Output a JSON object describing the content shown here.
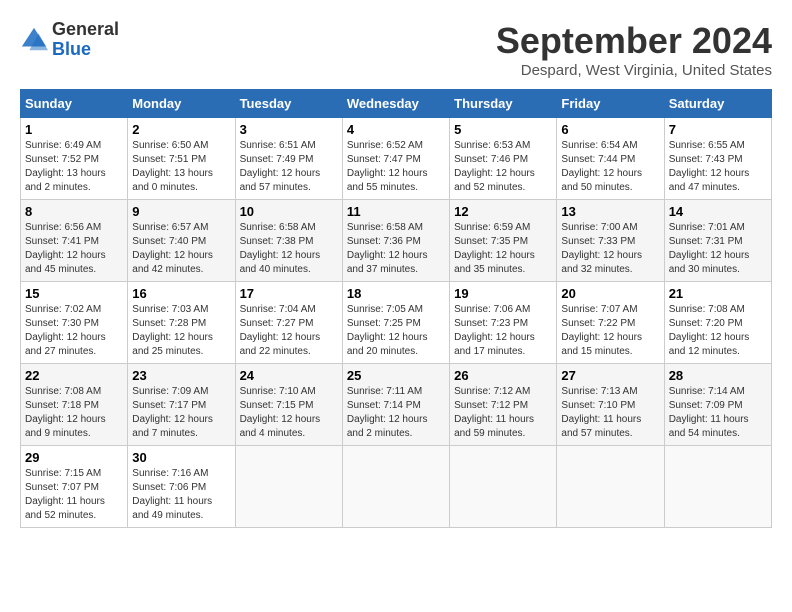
{
  "header": {
    "logo_general": "General",
    "logo_blue": "Blue",
    "month_title": "September 2024",
    "location": "Despard, West Virginia, United States"
  },
  "columns": [
    "Sunday",
    "Monday",
    "Tuesday",
    "Wednesday",
    "Thursday",
    "Friday",
    "Saturday"
  ],
  "weeks": [
    [
      {
        "day": "1",
        "sunrise": "6:49 AM",
        "sunset": "7:52 PM",
        "daylight": "13 hours and 2 minutes."
      },
      {
        "day": "2",
        "sunrise": "6:50 AM",
        "sunset": "7:51 PM",
        "daylight": "13 hours and 0 minutes."
      },
      {
        "day": "3",
        "sunrise": "6:51 AM",
        "sunset": "7:49 PM",
        "daylight": "12 hours and 57 minutes."
      },
      {
        "day": "4",
        "sunrise": "6:52 AM",
        "sunset": "7:47 PM",
        "daylight": "12 hours and 55 minutes."
      },
      {
        "day": "5",
        "sunrise": "6:53 AM",
        "sunset": "7:46 PM",
        "daylight": "12 hours and 52 minutes."
      },
      {
        "day": "6",
        "sunrise": "6:54 AM",
        "sunset": "7:44 PM",
        "daylight": "12 hours and 50 minutes."
      },
      {
        "day": "7",
        "sunrise": "6:55 AM",
        "sunset": "7:43 PM",
        "daylight": "12 hours and 47 minutes."
      }
    ],
    [
      {
        "day": "8",
        "sunrise": "6:56 AM",
        "sunset": "7:41 PM",
        "daylight": "12 hours and 45 minutes."
      },
      {
        "day": "9",
        "sunrise": "6:57 AM",
        "sunset": "7:40 PM",
        "daylight": "12 hours and 42 minutes."
      },
      {
        "day": "10",
        "sunrise": "6:58 AM",
        "sunset": "7:38 PM",
        "daylight": "12 hours and 40 minutes."
      },
      {
        "day": "11",
        "sunrise": "6:58 AM",
        "sunset": "7:36 PM",
        "daylight": "12 hours and 37 minutes."
      },
      {
        "day": "12",
        "sunrise": "6:59 AM",
        "sunset": "7:35 PM",
        "daylight": "12 hours and 35 minutes."
      },
      {
        "day": "13",
        "sunrise": "7:00 AM",
        "sunset": "7:33 PM",
        "daylight": "12 hours and 32 minutes."
      },
      {
        "day": "14",
        "sunrise": "7:01 AM",
        "sunset": "7:31 PM",
        "daylight": "12 hours and 30 minutes."
      }
    ],
    [
      {
        "day": "15",
        "sunrise": "7:02 AM",
        "sunset": "7:30 PM",
        "daylight": "12 hours and 27 minutes."
      },
      {
        "day": "16",
        "sunrise": "7:03 AM",
        "sunset": "7:28 PM",
        "daylight": "12 hours and 25 minutes."
      },
      {
        "day": "17",
        "sunrise": "7:04 AM",
        "sunset": "7:27 PM",
        "daylight": "12 hours and 22 minutes."
      },
      {
        "day": "18",
        "sunrise": "7:05 AM",
        "sunset": "7:25 PM",
        "daylight": "12 hours and 20 minutes."
      },
      {
        "day": "19",
        "sunrise": "7:06 AM",
        "sunset": "7:23 PM",
        "daylight": "12 hours and 17 minutes."
      },
      {
        "day": "20",
        "sunrise": "7:07 AM",
        "sunset": "7:22 PM",
        "daylight": "12 hours and 15 minutes."
      },
      {
        "day": "21",
        "sunrise": "7:08 AM",
        "sunset": "7:20 PM",
        "daylight": "12 hours and 12 minutes."
      }
    ],
    [
      {
        "day": "22",
        "sunrise": "7:08 AM",
        "sunset": "7:18 PM",
        "daylight": "12 hours and 9 minutes."
      },
      {
        "day": "23",
        "sunrise": "7:09 AM",
        "sunset": "7:17 PM",
        "daylight": "12 hours and 7 minutes."
      },
      {
        "day": "24",
        "sunrise": "7:10 AM",
        "sunset": "7:15 PM",
        "daylight": "12 hours and 4 minutes."
      },
      {
        "day": "25",
        "sunrise": "7:11 AM",
        "sunset": "7:14 PM",
        "daylight": "12 hours and 2 minutes."
      },
      {
        "day": "26",
        "sunrise": "7:12 AM",
        "sunset": "7:12 PM",
        "daylight": "11 hours and 59 minutes."
      },
      {
        "day": "27",
        "sunrise": "7:13 AM",
        "sunset": "7:10 PM",
        "daylight": "11 hours and 57 minutes."
      },
      {
        "day": "28",
        "sunrise": "7:14 AM",
        "sunset": "7:09 PM",
        "daylight": "11 hours and 54 minutes."
      }
    ],
    [
      {
        "day": "29",
        "sunrise": "7:15 AM",
        "sunset": "7:07 PM",
        "daylight": "11 hours and 52 minutes."
      },
      {
        "day": "30",
        "sunrise": "7:16 AM",
        "sunset": "7:06 PM",
        "daylight": "11 hours and 49 minutes."
      },
      null,
      null,
      null,
      null,
      null
    ]
  ]
}
